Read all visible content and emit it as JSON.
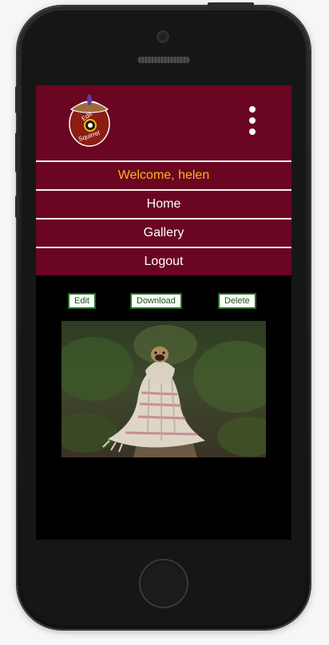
{
  "app": {
    "logo_text": [
      "Edit",
      "Squirrel"
    ]
  },
  "nav": {
    "welcome": "Welcome, helen",
    "home": "Home",
    "gallery": "Gallery",
    "logout": "Logout"
  },
  "actions": {
    "edit": "Edit",
    "download": "Download",
    "delete": "Delete"
  },
  "colors": {
    "header_bg": "#6a0522",
    "welcome_text": "#f4b91e",
    "button_border": "#1f6d1f"
  },
  "icons": {
    "menu": "kebab-menu-icon",
    "logo": "acorn-logo-icon"
  }
}
